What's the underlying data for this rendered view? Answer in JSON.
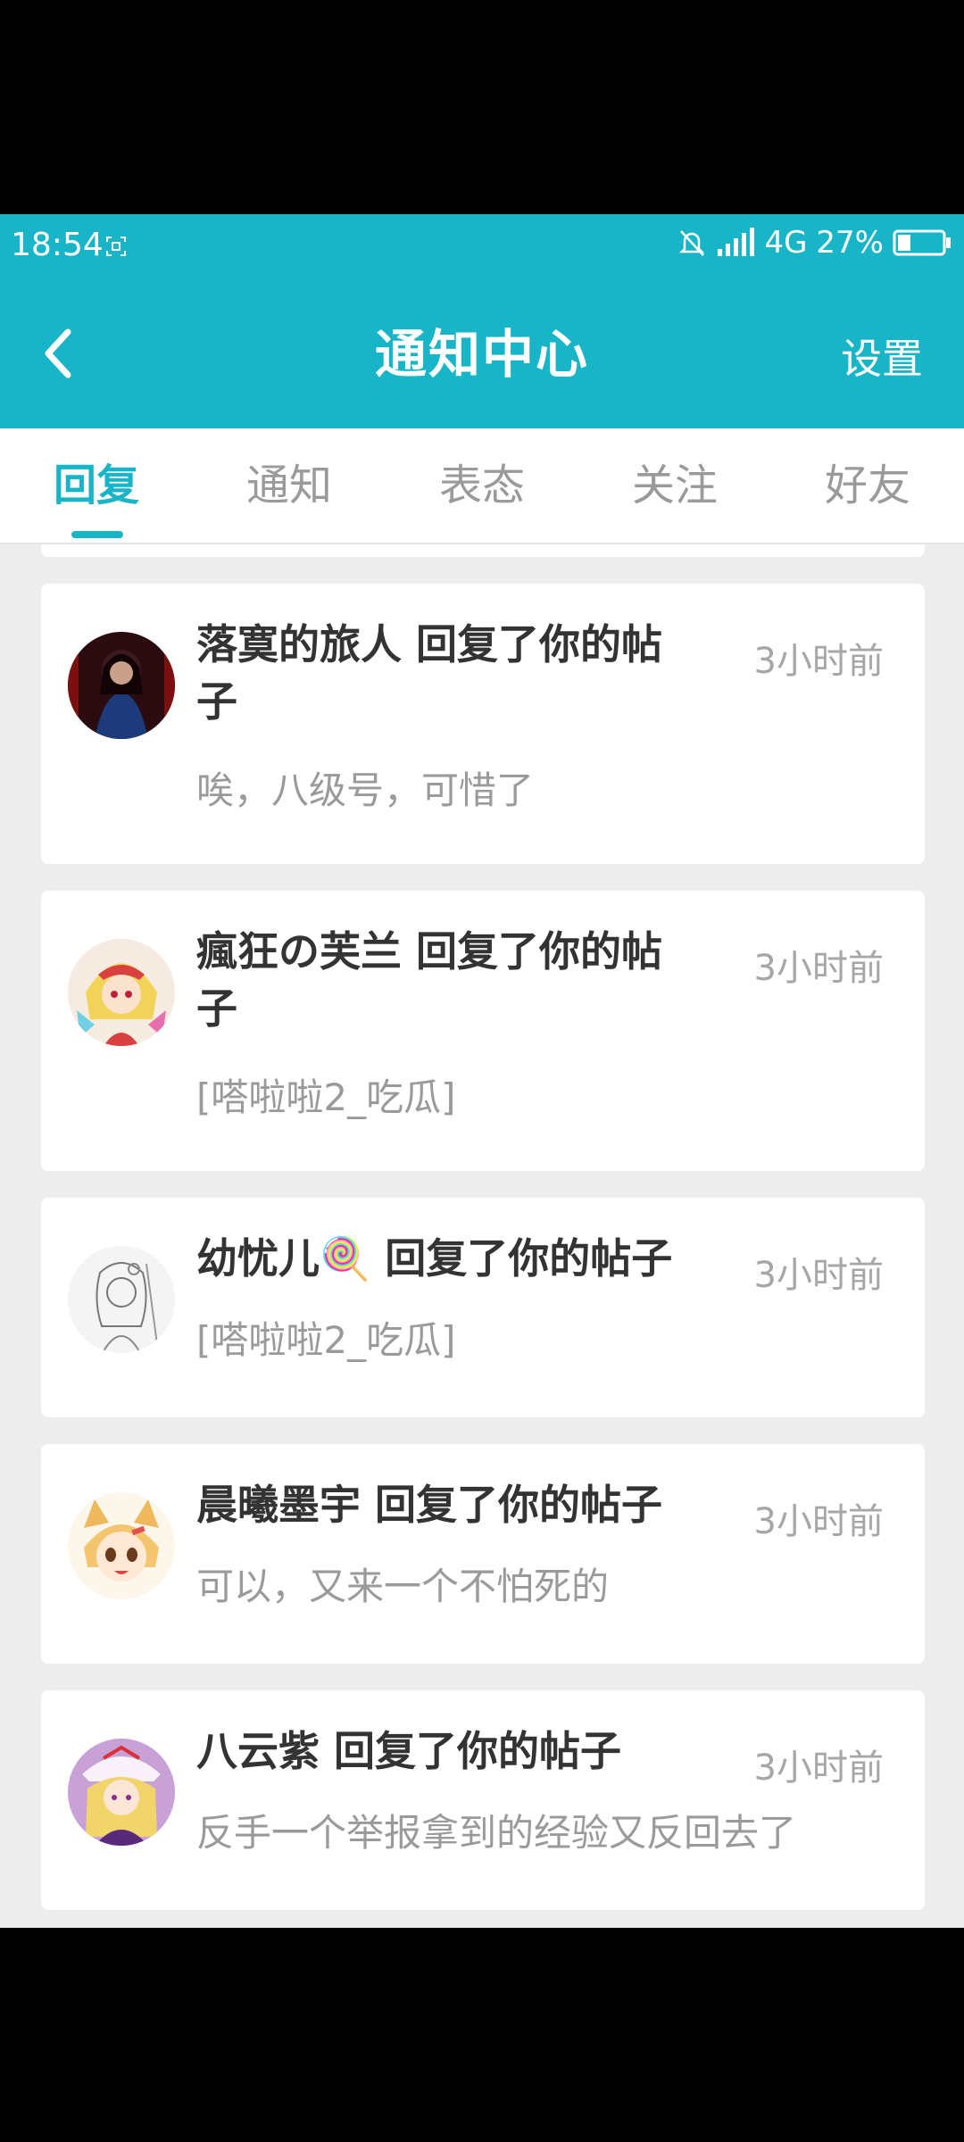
{
  "status": {
    "time": "18:54",
    "network": "4G",
    "battery": "27%"
  },
  "header": {
    "title": "通知中心",
    "settings_label": "设置"
  },
  "tabs": [
    {
      "label": "回复",
      "active": true
    },
    {
      "label": "通知",
      "active": false
    },
    {
      "label": "表态",
      "active": false
    },
    {
      "label": "关注",
      "active": false
    },
    {
      "label": "好友",
      "active": false
    }
  ],
  "notifications": [
    {
      "user": "落寞的旅人",
      "action": "回复了你的帖子",
      "time": "3小时前",
      "message": "唉，八级号，可惜了",
      "avatar": "avatar-dark-figure"
    },
    {
      "user": "瘋狂の芙兰",
      "action": "回复了你的帖子",
      "time": "3小时前",
      "message": "[嗒啦啦2_吃瓜]",
      "avatar": "avatar-blonde-girl"
    },
    {
      "user": "幼忧儿🍭",
      "action": "回复了你的帖子",
      "time": "3小时前",
      "message": "[嗒啦啦2_吃瓜]",
      "avatar": "avatar-sketch-girl"
    },
    {
      "user": "晨曦墨宇",
      "action": "回复了你的帖子",
      "time": "3小时前",
      "message": "可以，又来一个不怕死的",
      "avatar": "avatar-fox-girl"
    },
    {
      "user": "八云紫",
      "action": "回复了你的帖子",
      "time": "3小时前",
      "message": "反手一个举报拿到的经验又反回去了",
      "avatar": "avatar-purple-girl"
    }
  ],
  "colors": {
    "brand": "#18b5c9",
    "background": "#ededed",
    "title_text": "#333333",
    "secondary_text": "#9a9a9a"
  }
}
